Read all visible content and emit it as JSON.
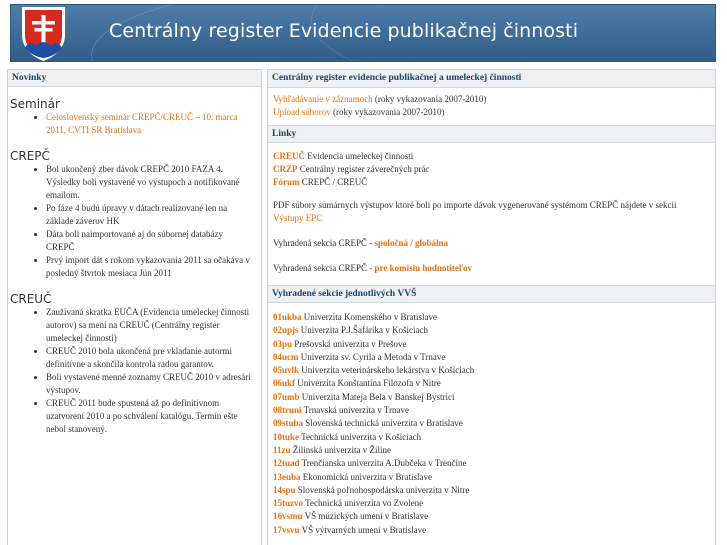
{
  "header": {
    "title": "Centrálny register Evidencie publikačnej činnosti"
  },
  "left": {
    "box_title": "Novinky",
    "sections": [
      {
        "title": "Seminár",
        "items": [
          {
            "text": "Celoslovenský seminár CREPČ/CREUČ – 10. marca 2011, CVTI SR Bratislava",
            "link": true
          }
        ]
      },
      {
        "title": "CREPČ",
        "items": [
          {
            "text": "Bol ukončený zber dávok CREPČ 2010 FAZA 4. Výsledky boli vystavené vo výstupoch a notifikované emailom.",
            "link": false
          },
          {
            "text": "Po fáze 4 budú úpravy v dátach realizované len na základe záverov HK",
            "link": false
          },
          {
            "text": "Dáta boli naimportované aj do súbornej databázy CREPČ",
            "link": false
          },
          {
            "text": "Prvý import dát s rokom vykazovania 2011 sa očakáva v posledný štvrtok mesiaca Jún 2011",
            "link": false
          }
        ]
      },
      {
        "title": "CREUČ",
        "items": [
          {
            "text": "Zaužívaná skratka EUČA (Evidencia umeleckej činnosti autorov) sa mení na CREUČ (Centrálny register umeleckej činnosti)",
            "link": false
          },
          {
            "text": "CREUČ 2010 bola ukončená pre vkladanie autormi definitívne a skončila kontrola radou garantov.",
            "link": false
          },
          {
            "text": "Boli vystavené menné zoznamy CREUČ 2010 v adresári výstupov.",
            "link": false
          },
          {
            "text": "CREUČ 2011 bude spustená až po definitívnom uzatvorení 2010 a po schválení katalógu. Termín ešte nebol stanovený.",
            "link": false
          }
        ]
      }
    ]
  },
  "right": {
    "main_title": "Centrálny register evidencie publikačnej a umeleckej činnosti",
    "main_links": [
      {
        "link": "Vyhľadávanie v záznamoch",
        "rest": " (roky vykazovania 2007-2010)"
      },
      {
        "link": "Upload súborov",
        "rest": " (roky vykazovania 2007-2010)"
      }
    ],
    "links_title": "Linky",
    "links": [
      {
        "link": "CREUČ",
        "rest": " Evidencia umeleckej činnosti"
      },
      {
        "link": "CRZP",
        "rest": " Centrálny register záverečných prác"
      },
      {
        "link": "Fórum",
        "rest": " CREPČ / CREUČ"
      }
    ],
    "pdf_text": "PDF súbory sumárnych výstupov ktoré boli po importe dávok vygenerované systémom CREPČ nájdete v sekcii",
    "pdf_link": "Výstupy EPC",
    "restricted1_text": "Vyhradená sekcia CREPČ - ",
    "restricted1_link": "spoločná / globálna",
    "restricted2_text": "Vyhradená sekcia CREPČ - ",
    "restricted2_link": "pre komisiu hodnotiteľov",
    "vvs_title": "Vyhradené sekcie jednotlivých VVŠ",
    "universities": [
      {
        "code": "01ukba",
        "name": "Univerzita Komenského v Bratislave"
      },
      {
        "code": "02upjs",
        "name": "Univerzita P.J.Šafárika v Košiciach"
      },
      {
        "code": "03pu",
        "name": "Prešovská univerzita v Prešove"
      },
      {
        "code": "04ucm",
        "name": "Univerzita sv. Cyrila a Metoda v Trnave"
      },
      {
        "code": "05uvlk",
        "name": "Univerzita veterinárskeho lekárstva v Košiciach"
      },
      {
        "code": "06ukf",
        "name": "Univerzita Konštantína Filozofa v Nitre"
      },
      {
        "code": "07umb",
        "name": "Univerzita Mateja Bela v Banskej Bystrici"
      },
      {
        "code": "08truni",
        "name": "Trnavská univerzita v Trnave"
      },
      {
        "code": "09stuba",
        "name": "Slovenská technická univerzita v Bratislave"
      },
      {
        "code": "10tuke",
        "name": "Technická univerzita v Košiciach"
      },
      {
        "code": "11zu",
        "name": "Žilinská univerzita v Žiline"
      },
      {
        "code": "12tuad",
        "name": "Trenčianska univerzita A.Dubčeka v Trenčíne"
      },
      {
        "code": "13euba",
        "name": "Ekonomická univerzita v Bratislave"
      },
      {
        "code": "14spu",
        "name": "Slovenská poľnohospodárska univerzita v Nitre"
      },
      {
        "code": "15tuzvo",
        "name": "Technická univerzita vo Zvolene"
      },
      {
        "code": "16vsmu",
        "name": "VŠ múzických umení v Bratislave"
      },
      {
        "code": "17vsvu",
        "name": "VŠ výtvarných umení v Bratislave"
      }
    ]
  },
  "colors": {
    "link": "#e8700e",
    "header_bg": "#3f6c98",
    "title_text": "#1f3f63",
    "box_bg": "#eef1f4"
  }
}
